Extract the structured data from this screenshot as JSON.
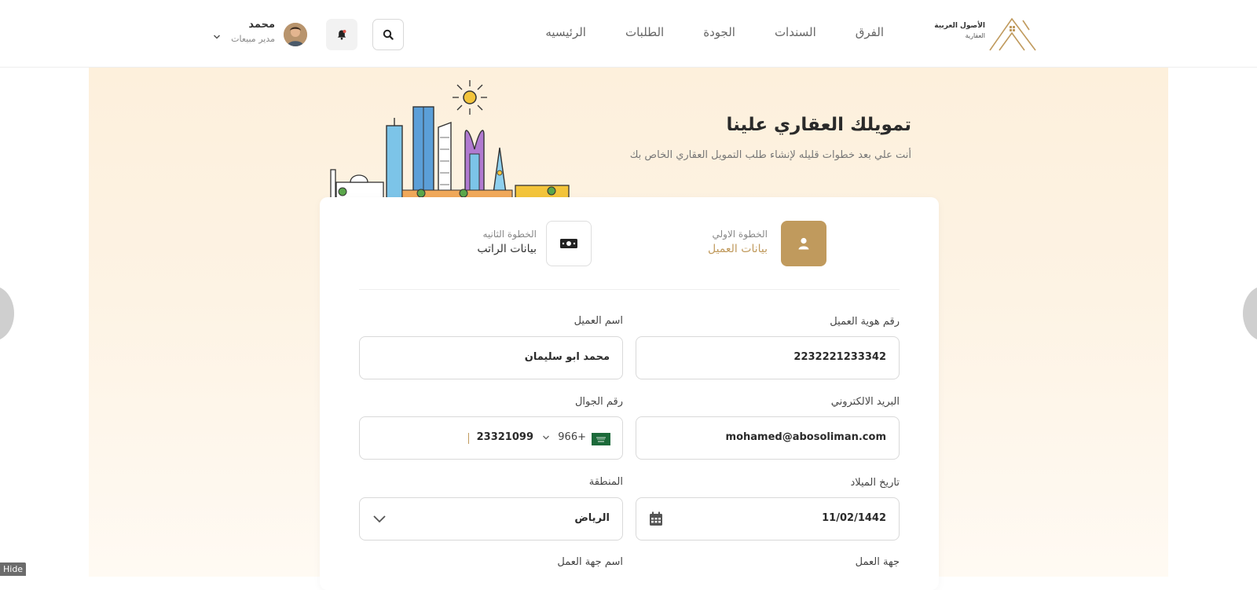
{
  "header": {
    "logo": {
      "line1": "الأصول العربية",
      "line2": "العقارية"
    },
    "nav": [
      {
        "label": "الرئيسيه"
      },
      {
        "label": "الطلبات"
      },
      {
        "label": "الجودة"
      },
      {
        "label": "السندات"
      },
      {
        "label": "الفرق"
      }
    ],
    "user": {
      "name": "محمد",
      "role": "مدير مبيعات"
    },
    "icons": [
      "search-icon",
      "bell-icon",
      "chevron-down-icon"
    ]
  },
  "hero": {
    "title": "تمويلك العقاري علينا",
    "subtitle": "أنت علي بعد خطوات قليله لإنشاء طلب التمويل العقاري الخاص بك"
  },
  "steps": [
    {
      "small": "الخطوة الاولي",
      "label": "بيانات العميل",
      "icon": "user-icon",
      "active": true
    },
    {
      "small": "الخطوة الثانيه",
      "label": "بيانات الراتب",
      "icon": "money-icon",
      "active": false
    }
  ],
  "form": {
    "id_number": {
      "label": "رقم هوية العميل",
      "value": "2232221233342"
    },
    "client_name": {
      "label": "اسم العميل",
      "value": "محمد ابو سليمان"
    },
    "email": {
      "label": "البريد الالكتروني",
      "value": "mohamed@abosoliman.com"
    },
    "phone": {
      "label": "رقم الجوال",
      "code": "966+",
      "value": "23321099"
    },
    "birth_date": {
      "label": "تاريخ الميلاد",
      "value": "11/02/1442"
    },
    "region": {
      "label": "المنطقة",
      "value": "الرياض"
    },
    "employer_type": {
      "label": "جهة العمل"
    },
    "employer_name": {
      "label": "اسم جهة العمل"
    }
  },
  "colors": {
    "accent": "#c09a5d",
    "hero_bg": "#fdf0dc"
  },
  "misc": {
    "hide_label": "Hide"
  }
}
